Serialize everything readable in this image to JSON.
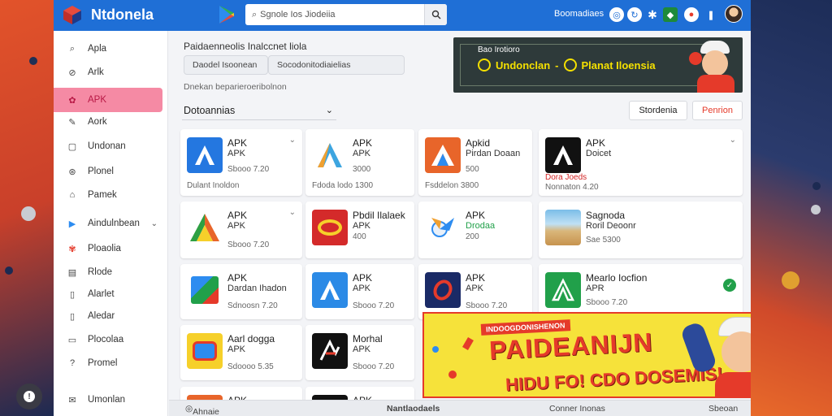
{
  "app": {
    "title": "Ntdonela"
  },
  "search": {
    "placeholder": "Sgnole Ios Jiodeiia"
  },
  "topbar": {
    "link": "Boomadiaes"
  },
  "sidebar": {
    "items": [
      {
        "label": "Apla",
        "icon": "search-icon"
      },
      {
        "label": "Arlk",
        "icon": "link-icon"
      },
      {
        "label": "APK",
        "icon": "gear-icon"
      },
      {
        "label": "Aork",
        "icon": "edit-icon"
      },
      {
        "label": "Undonan",
        "icon": "window-icon"
      },
      {
        "label": "Plonel",
        "icon": "tag-icon"
      },
      {
        "label": "Pamek",
        "icon": "bookmark-icon"
      },
      {
        "label": "Aindulnbean",
        "icon": "play-icon"
      },
      {
        "label": "Ploaolia",
        "icon": "flower-icon"
      },
      {
        "label": "Rlode",
        "icon": "document-icon"
      },
      {
        "label": "Alarlet",
        "icon": "page-icon"
      },
      {
        "label": "Aledar",
        "icon": "page-icon"
      },
      {
        "label": "Plocolaa",
        "icon": "phone-icon"
      },
      {
        "label": "Promel",
        "icon": "help-icon"
      },
      {
        "label": "Umonlan",
        "icon": "mail-icon"
      }
    ]
  },
  "main": {
    "heading": "Paidaenneolis Inalccnet liola",
    "filters": [
      "Daodel Isoonean",
      "Socodonitodiaielias"
    ],
    "subhead": "Dnekan beparieroeribolnon",
    "section": "Dotoannias",
    "buttons": {
      "secondary": "Stordenia",
      "primary": "Penrion"
    }
  },
  "promo": {
    "top": "Bao Irotioro",
    "left": "Undonclan",
    "right": "Planat Iloensia"
  },
  "cards": [
    {
      "t1": "APK",
      "t2": "APK",
      "t3": "Sbooo 7.20",
      "t4": "Dulant Inoldon"
    },
    {
      "t1": "APK",
      "t2": "APK",
      "t3": "3000",
      "t4": "Fdoda lodo 1300"
    },
    {
      "t1": "Apkid",
      "t2": "Pirdan Doaan",
      "t3": "500",
      "t4": "Fsddelon 3800"
    },
    {
      "t1": "APK",
      "t2": "Doicet",
      "t3": "Dora Joeds",
      "t4": "Nonnaton 4.20"
    },
    {
      "t1": "APK",
      "t2": "APK",
      "t3": "Sbooo 7.20",
      "t4": ""
    },
    {
      "t1": "Pbdil Ilalaek",
      "t2": "APK",
      "t3": "400",
      "t4": ""
    },
    {
      "t1": "APK",
      "t2": "Drodaa",
      "t3": "200",
      "t4": ""
    },
    {
      "t1": "Sagnoda",
      "t2": "Roril Deoonr",
      "t3": "Sae 5300",
      "t4": ""
    },
    {
      "t1": "APK",
      "t2": "Dardan Ihadon",
      "t3": "Sdnoosn 7.20",
      "t4": ""
    },
    {
      "t1": "APK",
      "t2": "APK",
      "t3": "Sbooo 7.20",
      "t4": ""
    },
    {
      "t1": "APK",
      "t2": "APK",
      "t3": "Sbooo 7.20",
      "t4": ""
    },
    {
      "t1": "Mearlo Iocfion",
      "t2": "APR",
      "t3": "Sbooo 7.20",
      "t4": ""
    },
    {
      "t1": "Aarl dogga",
      "t2": "APK",
      "t3": "Sdoooo 5.35",
      "t4": ""
    },
    {
      "t1": "Morhal",
      "t2": "APK",
      "t3": "Sbooo 7.20",
      "t4": ""
    }
  ],
  "ad": {
    "top": "INDOOGDONISHENON",
    "big": "PAIDEANIJN",
    "bottom": "HIDU FO! CDO DOSEMIS!"
  },
  "bottombar": {
    "left": "Ahnaie",
    "center": "Nantlaodaels",
    "right": "Conner Inonas",
    "far_right": "Sbeoan"
  },
  "colors": {
    "topbar": "#1f6fd6",
    "active": "#f58aa4",
    "primary": "#e53a2a",
    "ad": "#f6e23a"
  }
}
